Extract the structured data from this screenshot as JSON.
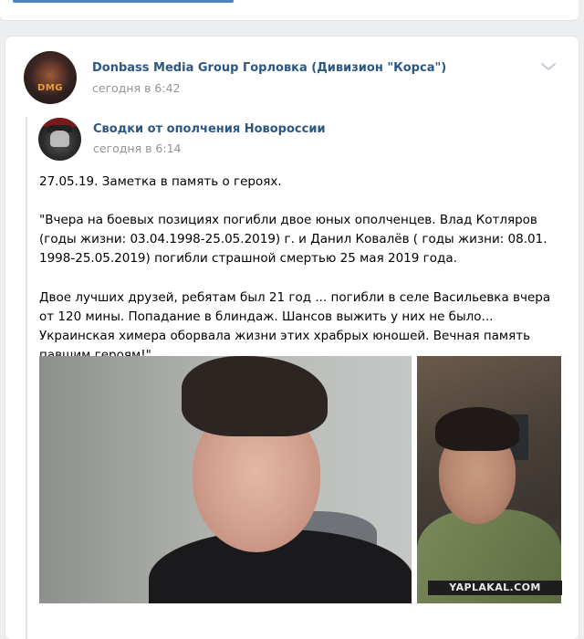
{
  "post": {
    "author": "Donbass Media Group Горловка (Дивизион \"Корса\")",
    "date": "сегодня в 6:42",
    "avatar_logo_text": "DMG"
  },
  "repost": {
    "author": "Сводки от ополчения Новороссии",
    "date": "сегодня в 6:14",
    "text_lines": [
      "27.05.19. Заметка в память о героях.",
      "\"Вчера на боевых позициях погибли двое юных ополченцев. Влад Котляров (годы жизни: 03.04.1998-25.05.2019) г. и Данил Ковалёв ( годы жизни: 08.01. 1998-25.05.2019) погибли страшной смертью 25 мая 2019 года.",
      "Двое лучших друзей, ребятам был 21 год ... погибли в селе Васильевка вчера от 120 мины. Попадание в блиндаж. Шансов выжить у них не было... Украинская химера оборвала жизни этих храбрых юношей. Вечная память павшим героям!\""
    ]
  },
  "watermark": "YAPLAKAL.COM",
  "colors": {
    "link": "#2a5885",
    "muted": "#939393",
    "page_bg": "#edeef0",
    "accent_bar": "#5181b8"
  },
  "icons": {
    "menu": "chevron-down-icon"
  }
}
